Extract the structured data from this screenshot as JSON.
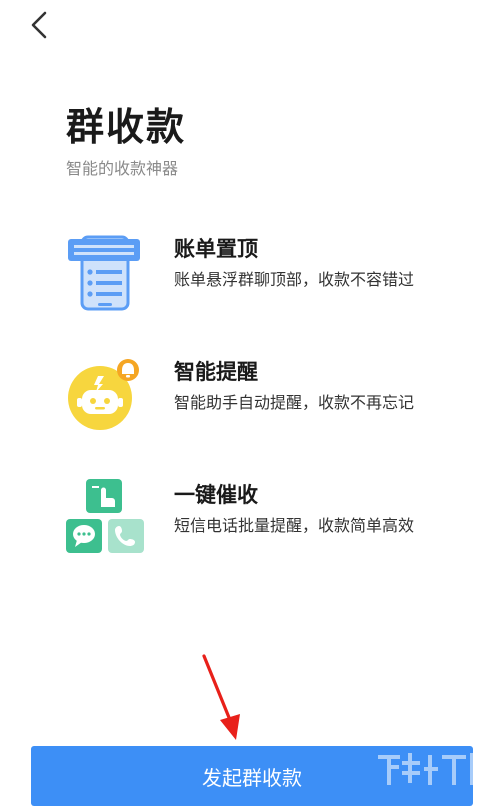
{
  "header": {
    "back_icon": "chevron-left-icon"
  },
  "page": {
    "title": "群收款",
    "subtitle": "智能的收款神器"
  },
  "features": [
    {
      "icon": "pinned-bill-phone-icon",
      "title": "账单置顶",
      "description": "账单悬浮群聊顶部，收款不容错过"
    },
    {
      "icon": "robot-reminder-icon",
      "title": "智能提醒",
      "description": "智能助手自动提醒，收款不再忘记"
    },
    {
      "icon": "one-tap-collect-icon",
      "title": "一键催收",
      "description": "短信电话批量提醒，收款简单高效"
    }
  ],
  "cta": {
    "label": "发起群收款"
  },
  "colors": {
    "accent": "#3d8ff6",
    "icon_blue": "#5b9df5",
    "icon_yellow": "#f7d63e",
    "icon_orange": "#f5a623",
    "icon_green": "#3dbf8f",
    "arrow_red": "#e8201a"
  }
}
